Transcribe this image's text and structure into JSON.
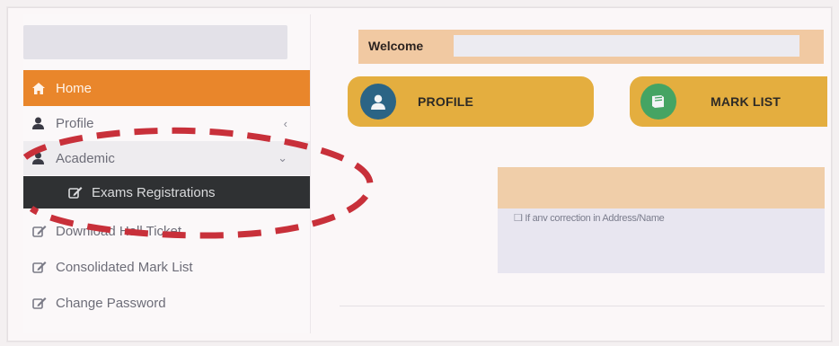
{
  "sidebar": {
    "items": [
      {
        "label": "Home",
        "icon": "home-icon"
      },
      {
        "label": "Profile",
        "icon": "user-icon",
        "caret": "‹"
      },
      {
        "label": "Academic",
        "icon": "user-icon",
        "caret": "⌄"
      },
      {
        "label": "Exams Registrations",
        "icon": "edit-icon"
      },
      {
        "label": "Download Hall Ticket",
        "icon": "edit-icon"
      },
      {
        "label": "Consolidated Mark List",
        "icon": "edit-icon"
      },
      {
        "label": "Change Password",
        "icon": "edit-icon"
      }
    ]
  },
  "main": {
    "welcome": "Welcome",
    "tiles": [
      {
        "label": "PROFILE",
        "icon": "user-icon"
      },
      {
        "label": "MARK LIST",
        "icon": "book-icon"
      }
    ],
    "notice_text": "If any correction in Address/Name"
  },
  "colors": {
    "accent": "#e9862b",
    "tile": "#e4ae3f",
    "submenu": "#2f3133",
    "annotation": "#c8303a"
  }
}
